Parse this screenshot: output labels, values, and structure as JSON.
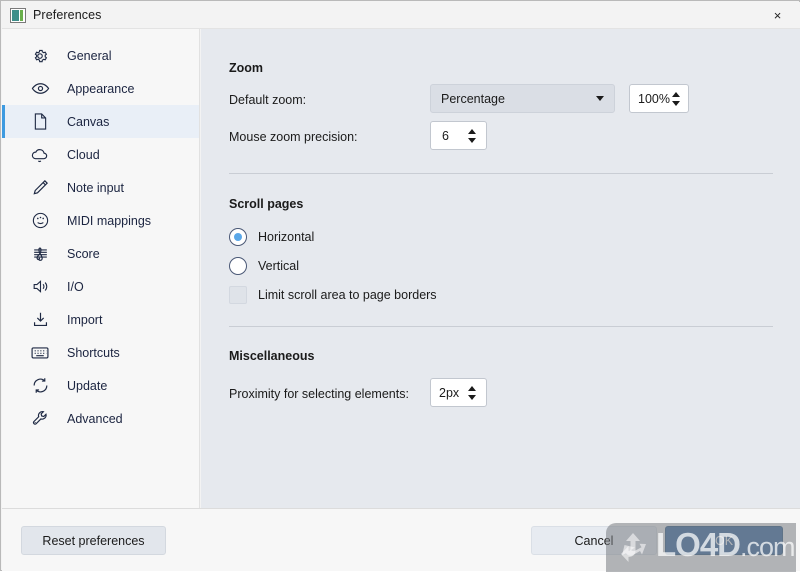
{
  "window": {
    "title": "Preferences",
    "app_icon": "app-icon",
    "close_label": "×"
  },
  "sidebar": {
    "items": [
      {
        "label": "General",
        "icon": "gear-icon"
      },
      {
        "label": "Appearance",
        "icon": "eye-icon"
      },
      {
        "label": "Canvas",
        "icon": "page-icon",
        "selected": true
      },
      {
        "label": "Cloud",
        "icon": "cloud-icon"
      },
      {
        "label": "Note input",
        "icon": "pencil-icon"
      },
      {
        "label": "MIDI mappings",
        "icon": "midi-icon"
      },
      {
        "label": "Score",
        "icon": "clef-icon"
      },
      {
        "label": "I/O",
        "icon": "speaker-icon"
      },
      {
        "label": "Import",
        "icon": "download-icon"
      },
      {
        "label": "Shortcuts",
        "icon": "keyboard-icon"
      },
      {
        "label": "Update",
        "icon": "refresh-icon"
      },
      {
        "label": "Advanced",
        "icon": "wrench-icon"
      }
    ]
  },
  "content": {
    "zoom_section": {
      "title": "Zoom",
      "default_zoom_label": "Default zoom:",
      "default_zoom_value": "Percentage",
      "default_zoom_options": [
        "Percentage"
      ],
      "zoom_percent_value": "100%",
      "precision_label": "Mouse zoom precision:",
      "precision_value": "6"
    },
    "scroll_section": {
      "title": "Scroll pages",
      "horizontal_label": "Horizontal",
      "vertical_label": "Vertical",
      "selected_direction": "Horizontal",
      "limit_label": "Limit scroll area to page borders",
      "limit_checked": false
    },
    "misc_section": {
      "title": "Miscellaneous",
      "proximity_label": "Proximity for selecting elements:",
      "proximity_value": "2px"
    }
  },
  "footer": {
    "reset_label": "Reset preferences",
    "cancel_label": "Cancel",
    "ok_label": "OK"
  },
  "watermark": {
    "brand": "LO4D",
    "suffix": ".com"
  },
  "colors": {
    "accent": "#3d9ae0",
    "ok_button": "#4a77a8",
    "radio_dot": "#5aa7e8",
    "content_bg": "#e6e9ee",
    "sidebar_bg": "#f7f7f7"
  }
}
